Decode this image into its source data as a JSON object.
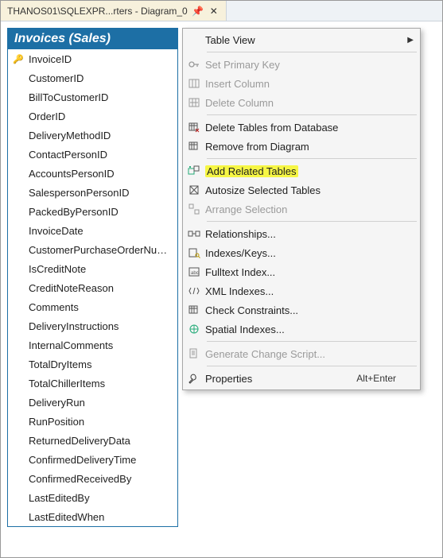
{
  "tab": {
    "title": "THANOS01\\SQLEXPR...rters - Diagram_0"
  },
  "table": {
    "title": "Invoices (Sales)",
    "columns": [
      {
        "name": "InvoiceID",
        "pk": true
      },
      {
        "name": "CustomerID",
        "pk": false
      },
      {
        "name": "BillToCustomerID",
        "pk": false
      },
      {
        "name": "OrderID",
        "pk": false
      },
      {
        "name": "DeliveryMethodID",
        "pk": false
      },
      {
        "name": "ContactPersonID",
        "pk": false
      },
      {
        "name": "AccountsPersonID",
        "pk": false
      },
      {
        "name": "SalespersonPersonID",
        "pk": false
      },
      {
        "name": "PackedByPersonID",
        "pk": false
      },
      {
        "name": "InvoiceDate",
        "pk": false
      },
      {
        "name": "CustomerPurchaseOrderNumber",
        "pk": false
      },
      {
        "name": "IsCreditNote",
        "pk": false
      },
      {
        "name": "CreditNoteReason",
        "pk": false
      },
      {
        "name": "Comments",
        "pk": false
      },
      {
        "name": "DeliveryInstructions",
        "pk": false
      },
      {
        "name": "InternalComments",
        "pk": false
      },
      {
        "name": "TotalDryItems",
        "pk": false
      },
      {
        "name": "TotalChillerItems",
        "pk": false
      },
      {
        "name": "DeliveryRun",
        "pk": false
      },
      {
        "name": "RunPosition",
        "pk": false
      },
      {
        "name": "ReturnedDeliveryData",
        "pk": false
      },
      {
        "name": "ConfirmedDeliveryTime",
        "pk": false
      },
      {
        "name": "ConfirmedReceivedBy",
        "pk": false
      },
      {
        "name": "LastEditedBy",
        "pk": false
      },
      {
        "name": "LastEditedWhen",
        "pk": false
      }
    ]
  },
  "menu": {
    "table_view": "Table View",
    "set_pk": "Set Primary Key",
    "insert_col": "Insert Column",
    "delete_col": "Delete Column",
    "delete_tables": "Delete Tables from Database",
    "remove_diag": "Remove from Diagram",
    "add_related": "Add Related Tables",
    "autosize": "Autosize Selected Tables",
    "arrange": "Arrange Selection",
    "relationships": "Relationships...",
    "indexes": "Indexes/Keys...",
    "fulltext": "Fulltext Index...",
    "xml": "XML Indexes...",
    "check": "Check Constraints...",
    "spatial": "Spatial Indexes...",
    "gen_script": "Generate Change Script...",
    "properties": "Properties",
    "properties_shortcut": "Alt+Enter"
  }
}
